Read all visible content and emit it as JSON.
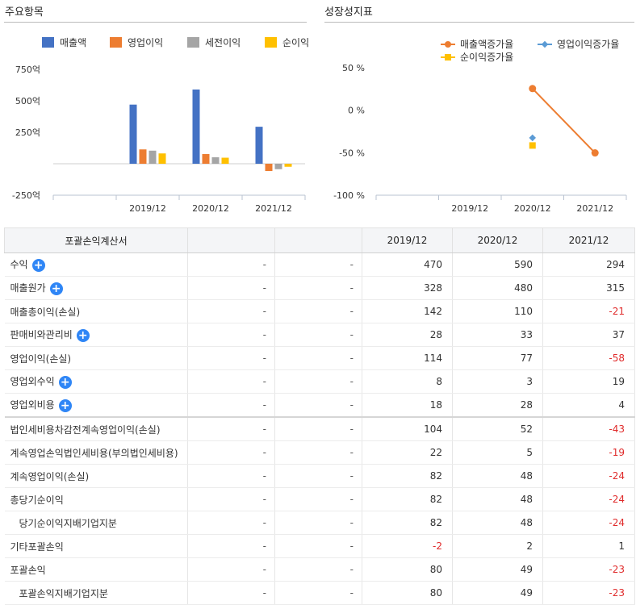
{
  "left_title": "주요항목",
  "right_title": "성장성지표",
  "chart_data": [
    {
      "type": "bar",
      "title": "주요항목",
      "categories": [
        "",
        "2019/12",
        "2020/12",
        "2021/12"
      ],
      "series": [
        {
          "name": "매출액",
          "color": "#4472c4",
          "values": [
            null,
            470,
            590,
            294
          ]
        },
        {
          "name": "영업이익",
          "color": "#ed7d31",
          "values": [
            null,
            114,
            77,
            -58
          ]
        },
        {
          "name": "세전이익",
          "color": "#a5a5a5",
          "values": [
            null,
            104,
            52,
            -43
          ]
        },
        {
          "name": "순이익",
          "color": "#ffc000",
          "values": [
            null,
            82,
            48,
            -24
          ]
        }
      ],
      "ylim": [
        -250,
        750
      ],
      "yticks": [
        750,
        500,
        250,
        -250
      ],
      "ytick_labels": [
        "750억",
        "500억",
        "250억",
        "-250억"
      ],
      "legend_position": "top"
    },
    {
      "type": "line",
      "title": "성장성지표",
      "categories": [
        "",
        "2019/12",
        "2020/12",
        "2021/12"
      ],
      "series": [
        {
          "name": "매출액증가율",
          "color": "#ed7d31",
          "values": [
            null,
            null,
            25.5,
            -50.2
          ]
        },
        {
          "name": "영업이익증가율",
          "color": "#5b9bd5",
          "values": [
            null,
            null,
            -32.5,
            null
          ]
        },
        {
          "name": "순이익증가율",
          "color": "#ffc000",
          "values": [
            null,
            null,
            -41.5,
            null
          ]
        }
      ],
      "ylim": [
        -100,
        50
      ],
      "yticks": [
        50,
        0,
        -50,
        -100
      ],
      "ytick_labels": [
        "50 %",
        "0 %",
        "-50 %",
        "-100 %"
      ],
      "legend_position": "top"
    }
  ],
  "table": {
    "headers": [
      "포괄손익계산서",
      "",
      "",
      "2019/12",
      "2020/12",
      "2021/12"
    ],
    "rows": [
      {
        "name": "수익",
        "plus": true,
        "indent": false,
        "sep": false,
        "c1": "-",
        "c2": "-",
        "v": [
          "470",
          "590",
          "294"
        ],
        "neg": [
          false,
          false,
          false
        ]
      },
      {
        "name": "매출원가",
        "plus": true,
        "indent": false,
        "sep": false,
        "c1": "-",
        "c2": "-",
        "v": [
          "328",
          "480",
          "315"
        ],
        "neg": [
          false,
          false,
          false
        ]
      },
      {
        "name": "매출총이익(손실)",
        "plus": false,
        "indent": false,
        "sep": false,
        "c1": "-",
        "c2": "-",
        "v": [
          "142",
          "110",
          "-21"
        ],
        "neg": [
          false,
          false,
          true
        ]
      },
      {
        "name": "판매비와관리비",
        "plus": true,
        "indent": false,
        "sep": false,
        "c1": "-",
        "c2": "-",
        "v": [
          "28",
          "33",
          "37"
        ],
        "neg": [
          false,
          false,
          false
        ]
      },
      {
        "name": "영업이익(손실)",
        "plus": false,
        "indent": false,
        "sep": false,
        "c1": "-",
        "c2": "-",
        "v": [
          "114",
          "77",
          "-58"
        ],
        "neg": [
          false,
          false,
          true
        ]
      },
      {
        "name": "영업외수익",
        "plus": true,
        "indent": false,
        "sep": false,
        "c1": "-",
        "c2": "-",
        "v": [
          "8",
          "3",
          "19"
        ],
        "neg": [
          false,
          false,
          false
        ]
      },
      {
        "name": "영업외비용",
        "plus": true,
        "indent": false,
        "sep": false,
        "c1": "-",
        "c2": "-",
        "v": [
          "18",
          "28",
          "4"
        ],
        "neg": [
          false,
          false,
          false
        ]
      },
      {
        "name": "법인세비용차감전계속영업이익(손실)",
        "plus": false,
        "indent": false,
        "sep": true,
        "c1": "-",
        "c2": "-",
        "v": [
          "104",
          "52",
          "-43"
        ],
        "neg": [
          false,
          false,
          true
        ]
      },
      {
        "name": "계속영업손익법인세비용(부의법인세비용)",
        "plus": false,
        "indent": false,
        "sep": false,
        "c1": "-",
        "c2": "-",
        "v": [
          "22",
          "5",
          "-19"
        ],
        "neg": [
          false,
          false,
          true
        ]
      },
      {
        "name": "계속영업이익(손실)",
        "plus": false,
        "indent": false,
        "sep": false,
        "c1": "-",
        "c2": "-",
        "v": [
          "82",
          "48",
          "-24"
        ],
        "neg": [
          false,
          false,
          true
        ]
      },
      {
        "name": "총당기순이익",
        "plus": false,
        "indent": false,
        "sep": false,
        "c1": "-",
        "c2": "-",
        "v": [
          "82",
          "48",
          "-24"
        ],
        "neg": [
          false,
          false,
          true
        ]
      },
      {
        "name": "당기순이익지배기업지분",
        "plus": false,
        "indent": true,
        "sep": false,
        "c1": "-",
        "c2": "-",
        "v": [
          "82",
          "48",
          "-24"
        ],
        "neg": [
          false,
          false,
          true
        ]
      },
      {
        "name": "기타포괄손익",
        "plus": false,
        "indent": false,
        "sep": false,
        "c1": "-",
        "c2": "-",
        "v": [
          "-2",
          "2",
          "1"
        ],
        "neg": [
          true,
          false,
          false
        ]
      },
      {
        "name": "포괄손익",
        "plus": false,
        "indent": false,
        "sep": false,
        "c1": "-",
        "c2": "-",
        "v": [
          "80",
          "49",
          "-23"
        ],
        "neg": [
          false,
          false,
          true
        ]
      },
      {
        "name": "포괄손익지배기업지분",
        "plus": false,
        "indent": true,
        "sep": false,
        "c1": "-",
        "c2": "-",
        "v": [
          "80",
          "49",
          "-23"
        ],
        "neg": [
          false,
          false,
          true
        ]
      }
    ]
  }
}
